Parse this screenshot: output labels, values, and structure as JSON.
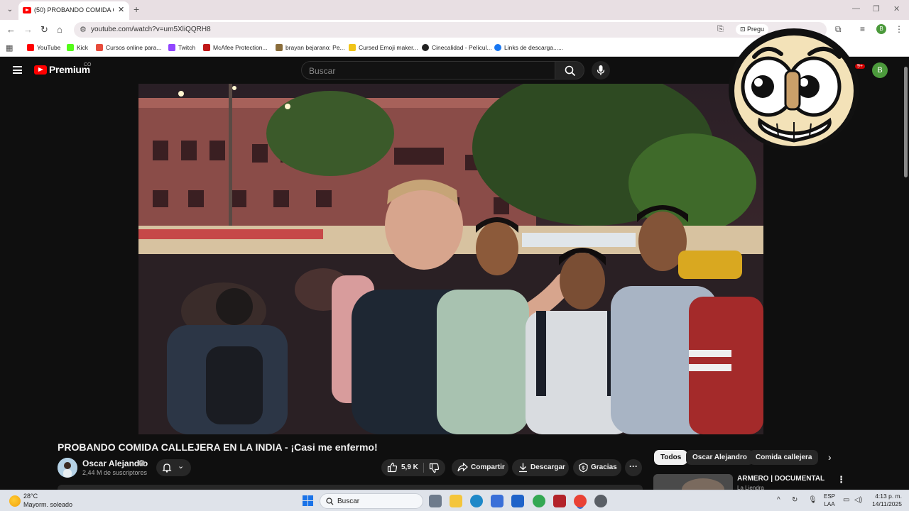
{
  "browser": {
    "tab_title": "(50) PROBANDO COMIDA CALLE",
    "url": "youtube.com/watch?v=um5XliQQRH8",
    "pregunta_label": "Pregu",
    "bookmarks": [
      {
        "label": "YouTube",
        "color": "#ff0000"
      },
      {
        "label": "Kick",
        "color": "#53fc18"
      },
      {
        "label": "Cursos online para...",
        "color": "#e74c3c"
      },
      {
        "label": "Twitch",
        "color": "#9146ff"
      },
      {
        "label": "McAfee Protection...",
        "color": "#c01818"
      },
      {
        "label": "brayan bejarano: Pe...",
        "color": "#8a6d3b"
      },
      {
        "label": "Cursed Emoji maker...",
        "color": "#f0c419"
      },
      {
        "label": "Cinecalidad - Películ...",
        "color": "#222222"
      },
      {
        "label": "Links de descarga......",
        "color": "#1877f2"
      }
    ],
    "profile_initial": "B"
  },
  "youtube": {
    "brand": "Premium",
    "country": "CO",
    "search_placeholder": "Buscar",
    "notifications": "9+",
    "avatar_initial": "B"
  },
  "video": {
    "title": "PROBANDO COMIDA CALLEJERA EN LA INDIA - ¡Casi me enfermo!",
    "channel": "Oscar Alejandro",
    "subscribers": "2,44 M de suscriptores",
    "likes": "5,9 K",
    "share_label": "Compartir",
    "download_label": "Descargar",
    "thanks_label": "Gracias",
    "more_label": "···"
  },
  "chips": [
    "Todos",
    "Oscar Alejandro",
    "Comida callejera"
  ],
  "recommendation": {
    "title": "ARMERO | DOCUMENTAL",
    "channel": "La Liendra"
  },
  "taskbar": {
    "temperature": "28°C",
    "weather": "Mayorm. soleado",
    "search_label": "Buscar",
    "lang_top": "ESP",
    "lang_bottom": "LAA",
    "time": "4:13 p. m.",
    "date": "14/11/2025"
  },
  "colors": {
    "yt_red": "#ff0000",
    "bg_dark": "#0f0f0f",
    "pill_bg": "#272727",
    "profile_green": "#4c9a3c"
  }
}
